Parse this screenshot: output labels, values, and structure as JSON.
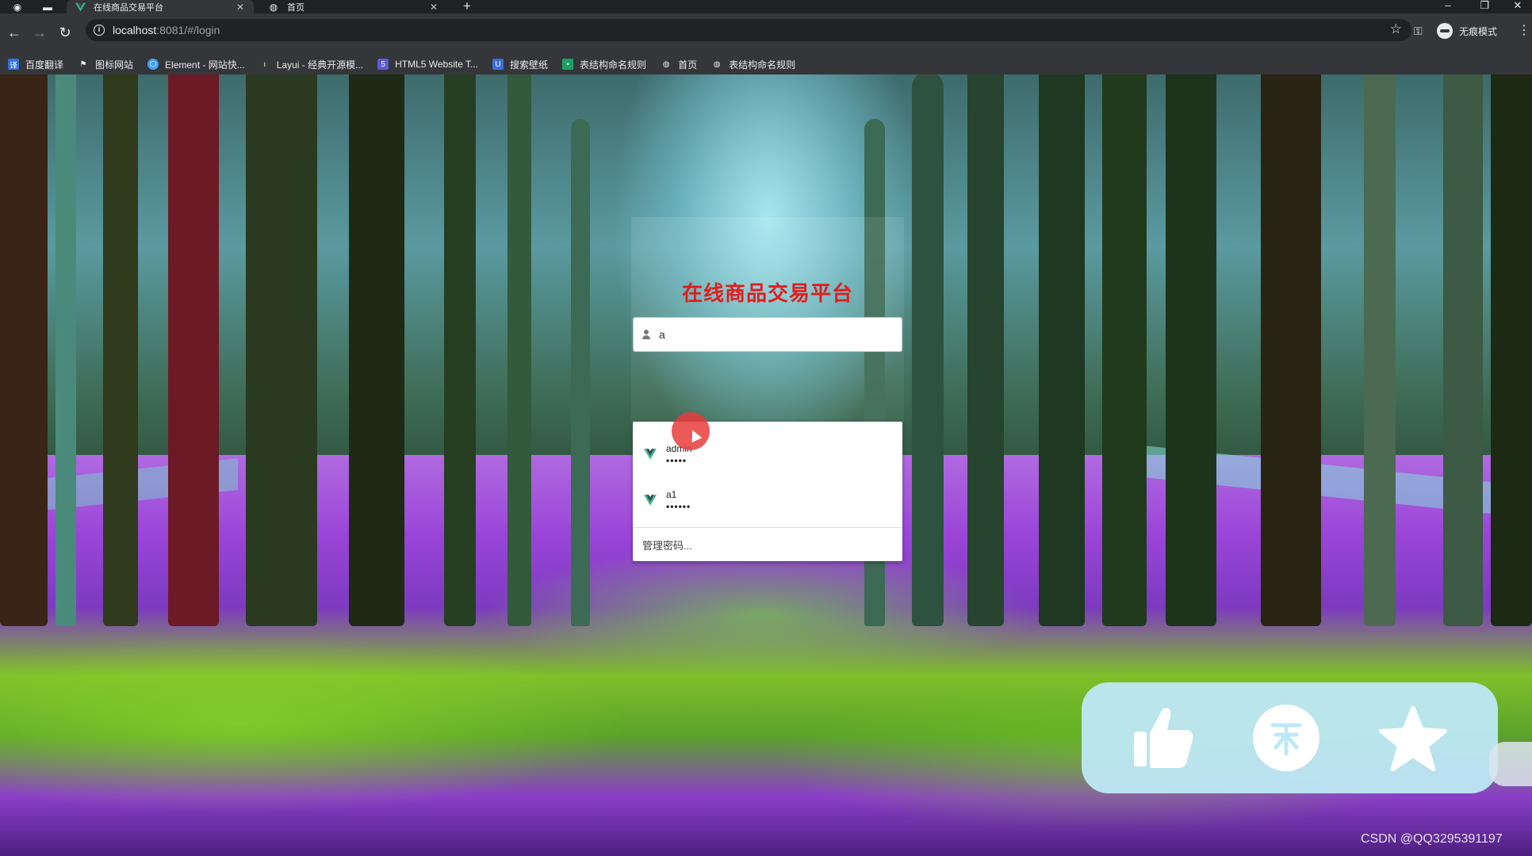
{
  "browser": {
    "tabs": [
      {
        "title": "在线商品交易平台",
        "favicon": "vue-icon",
        "active": true
      },
      {
        "title": "首页",
        "favicon": "globe-icon",
        "active": false
      }
    ],
    "url_host": "localhost",
    "url_path": ":8081/#/login",
    "profile_label": "无痕模式",
    "bookmarks": [
      {
        "label": "百度翻译",
        "icon": "baidu-translate-icon",
        "color": "#2f6fe4"
      },
      {
        "label": "图标网站",
        "icon": "flag-icon",
        "color": "#5f6368"
      },
      {
        "label": "Element - 网站快...",
        "icon": "element-icon",
        "color": "#409eff"
      },
      {
        "label": "Layui - 经典开源模...",
        "icon": "layui-icon",
        "color": "#5f6368"
      },
      {
        "label": "HTML5 Website T...",
        "icon": "html5-icon",
        "color": "#5b5bd6"
      },
      {
        "label": "搜索壁纸",
        "icon": "wallpaper-icon",
        "color": "#3b6fd6"
      },
      {
        "label": "表结构命名规则",
        "icon": "bookmark-green-icon",
        "color": "#1aa260"
      },
      {
        "label": "首页",
        "icon": "globe-icon",
        "color": "#5f6368"
      },
      {
        "label": "表结构命名规则",
        "icon": "globe-icon",
        "color": "#5f6368"
      }
    ]
  },
  "login": {
    "title": "在线商品交易平台",
    "username_value": "a",
    "accent_color": "#e21d1d"
  },
  "autofill": {
    "items": [
      {
        "username": "admin",
        "password_mask": "•••••"
      },
      {
        "username": "a1",
        "password_mask": "••••••"
      }
    ],
    "manage_label": "管理密码..."
  },
  "overlay": {
    "buttons": [
      "thumbs-up-icon",
      "coin-icon",
      "star-icon"
    ]
  },
  "watermark": "CSDN @QQ3295391197"
}
